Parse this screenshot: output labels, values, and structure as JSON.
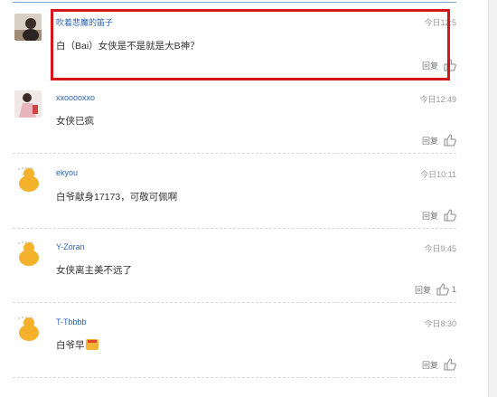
{
  "comments": [
    {
      "username": "吹着悲魔的笛子",
      "time": "今日12:5",
      "content": "白（Bai）女侠是不是就是大B神？",
      "reply_label": "回复",
      "likes": "",
      "avatar": "photo-dark"
    },
    {
      "username": "xxooooxxo",
      "time": "今日12:49",
      "content": "女侠已疯",
      "reply_label": "回复",
      "likes": "",
      "avatar": "photo-pink"
    },
    {
      "username": "ekyou",
      "time": "今日10:11",
      "content": "白爷献身17173，可敬可佩啊",
      "reply_label": "回复",
      "likes": "",
      "avatar": "default-mascot"
    },
    {
      "username": "Y-Zoran",
      "time": "今日9:45",
      "content": "女侠离主美不远了",
      "reply_label": "回复",
      "likes": "1",
      "avatar": "default-mascot"
    },
    {
      "username": "T-Tbbbb",
      "time": "今日8:30",
      "content": "白爷早",
      "reply_label": "回复",
      "likes": "",
      "avatar": "default-mascot"
    }
  ],
  "colors": {
    "username": "#2a63b3",
    "highlight_border": "#d4151c",
    "mascot": "#f3b12c"
  }
}
